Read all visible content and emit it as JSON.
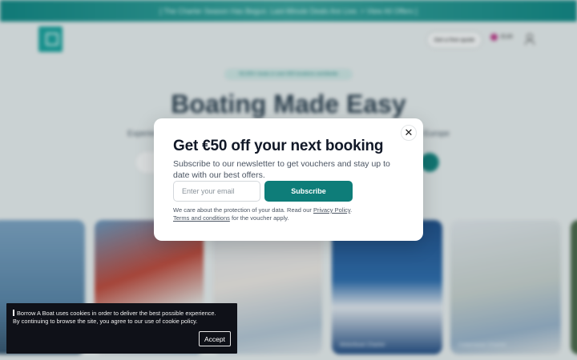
{
  "promo_bar": {
    "text": "[ The Charter Season Has Begun. Last-Minute Deals Are Live. > View All Offers ]"
  },
  "header": {
    "quote_button": "Get a free quote",
    "language": "EUR"
  },
  "hero": {
    "badge": "50,000+ boats in over 600 locations worldwide",
    "title": "Boating Made Easy",
    "subtitle": "Experience the freedom of the open sea with the largest selection of boat rentals in Europe"
  },
  "cards": [
    {
      "label": ""
    },
    {
      "label": ""
    },
    {
      "label": ""
    },
    {
      "label": "Motorboat Charter"
    },
    {
      "label": "Catamaran Charter"
    },
    {
      "label": ""
    }
  ],
  "modal": {
    "close_glyph": "✕",
    "title": "Get €50 off your next booking",
    "description": "Subscribe to our newsletter to get vouchers and stay up to date with our best offers.",
    "email_placeholder": "Enter your email",
    "subscribe_label": "Subscribe",
    "note_prefix": "We care about the protection of your data. Read our ",
    "privacy_link": "Privacy Policy",
    "note_mid": ".",
    "terms_link": "Terms and conditions",
    "note_suffix": " for the voucher apply."
  },
  "cookie": {
    "line1": "Borrow A Boat uses cookies in order to deliver the best possible experience.",
    "line2": "By continuing to browse the site, you agree to our use of cookie policy.",
    "accept_label": "Accept"
  },
  "colors": {
    "brand_teal": "#0e7d79",
    "cookie_bg": "#0f1118"
  }
}
